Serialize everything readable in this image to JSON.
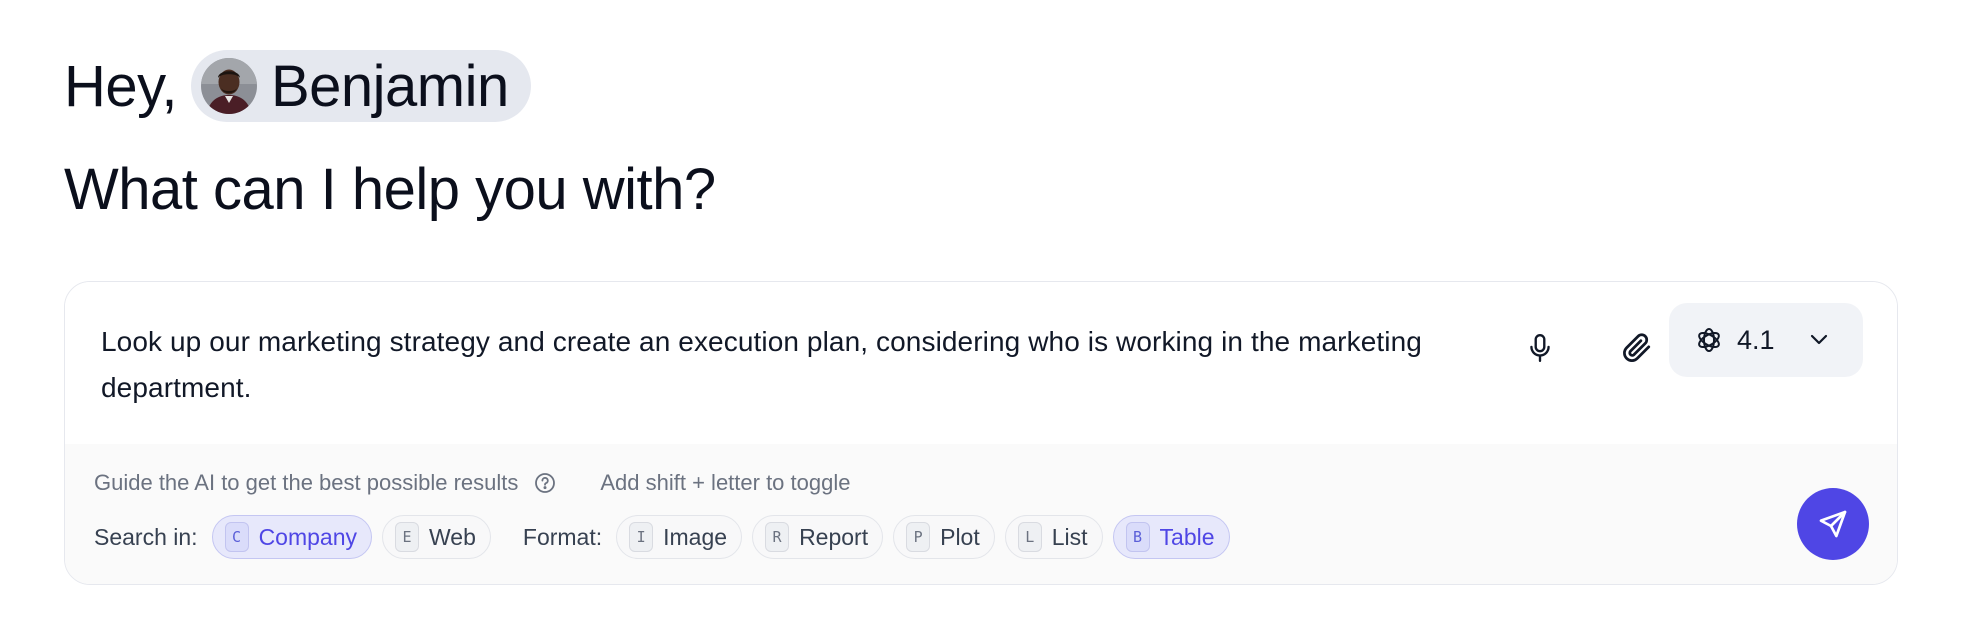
{
  "greeting": {
    "hey": "Hey,",
    "user_name": "Benjamin",
    "headline": "What can I help you with?"
  },
  "composer": {
    "prompt": "Look up our marketing strategy and create an execution plan, considering who is working in the marketing department.",
    "model": "4.1",
    "guide_text": "Guide the AI to get the best possible results",
    "toggle_hint": "Add shift + letter to toggle",
    "search_label": "Search in:",
    "format_label": "Format:",
    "search_options": [
      {
        "key": "C",
        "label": "Company",
        "active": true
      },
      {
        "key": "E",
        "label": "Web",
        "active": false
      }
    ],
    "format_options": [
      {
        "key": "I",
        "label": "Image",
        "active": false
      },
      {
        "key": "R",
        "label": "Report",
        "active": false
      },
      {
        "key": "P",
        "label": "Plot",
        "active": false
      },
      {
        "key": "L",
        "label": "List",
        "active": false
      },
      {
        "key": "B",
        "label": "Table",
        "active": true
      }
    ]
  },
  "icons": {
    "mic": "microphone-icon",
    "attach": "paperclip-icon",
    "model": "openai-logo-icon",
    "dropdown": "chevron-down-icon",
    "help": "question-circle-icon",
    "send": "send-icon"
  },
  "colors": {
    "accent": "#4f46e5",
    "chip_bg": "#e5e8ef",
    "active_chip_bg": "#e7e8fb"
  }
}
